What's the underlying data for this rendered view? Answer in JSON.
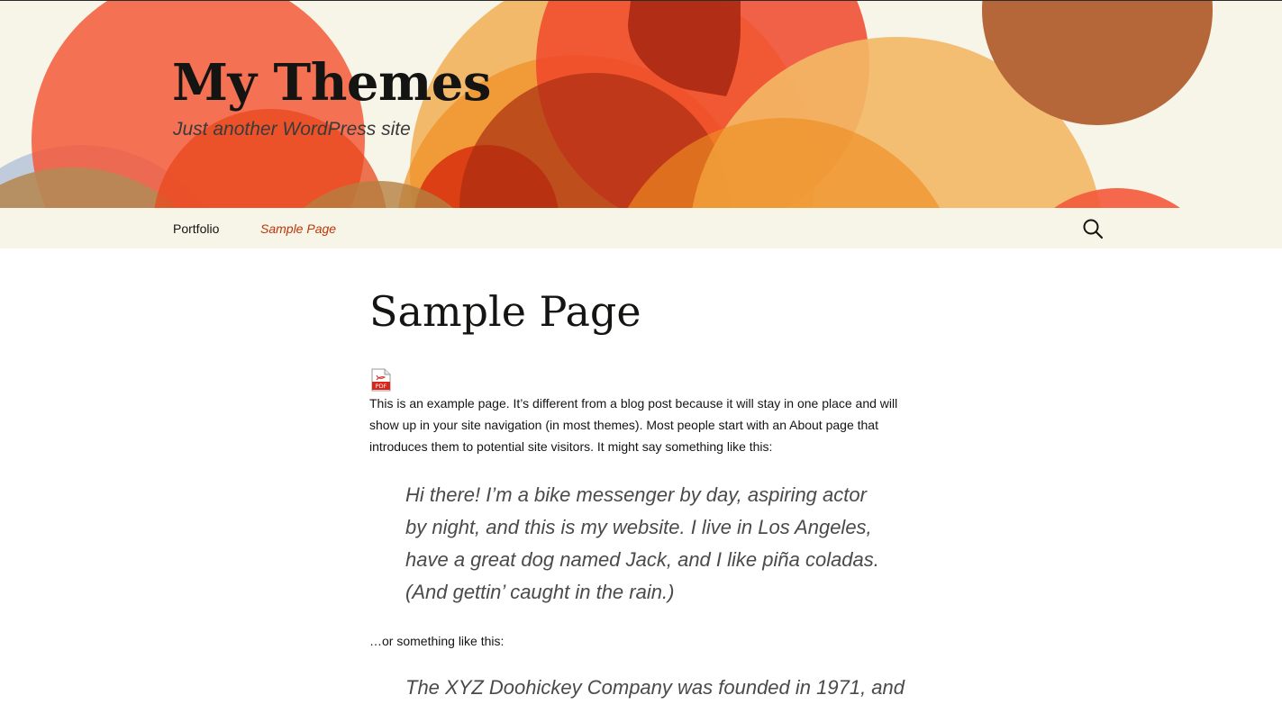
{
  "site": {
    "title": "My Themes",
    "description": "Just another WordPress site"
  },
  "nav": {
    "items": [
      {
        "label": "Portfolio",
        "current": false
      },
      {
        "label": "Sample Page",
        "current": true
      }
    ],
    "search_icon": "search-icon"
  },
  "page": {
    "title": "Sample Page",
    "attachment_icon": "pdf-icon",
    "intro": "This is an example page. It’s different from a blog post because it will stay in one place and will show up in your site navigation (in most themes). Most people start with an About page that introduces them to potential site visitors. It might say something like this:",
    "quote1": "Hi there! I’m a bike messenger by day, aspiring actor by night, and this is my website. I live in Los Angeles, have a great dog named Jack, and I like piña coladas. (And gettin’ caught in the rain.)",
    "or_text": "…or something like this:",
    "quote2": "The XYZ Doohickey Company was founded in 1971, and"
  },
  "colors": {
    "header_bg": "#f7f4e8",
    "nav_bg": "#f7f5e7",
    "accent": "#bc360a",
    "text": "#141412"
  }
}
